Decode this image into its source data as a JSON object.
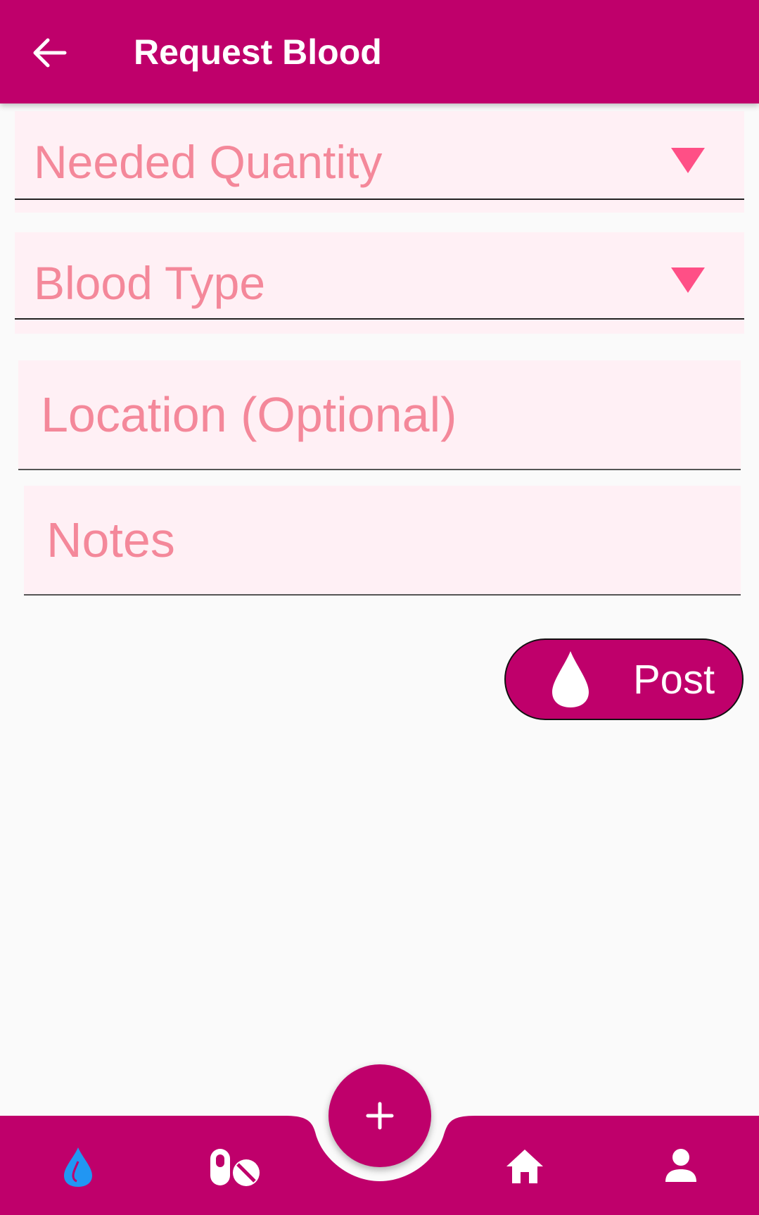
{
  "appbar": {
    "title": "Request Blood"
  },
  "form": {
    "quantity": {
      "label": "Needed Quantity"
    },
    "blood_type": {
      "label": "Blood Type"
    },
    "location": {
      "placeholder": "Location (Optional)",
      "value": ""
    },
    "notes": {
      "placeholder": "Notes",
      "value": ""
    }
  },
  "post_button": {
    "label": "Post"
  },
  "bottom_nav": {
    "items": [
      {
        "icon": "blood-drop-icon",
        "active": true
      },
      {
        "icon": "pills-icon",
        "active": false
      },
      {
        "icon": "add-icon",
        "active": false
      },
      {
        "icon": "home-icon",
        "active": false
      },
      {
        "icon": "profile-icon",
        "active": false
      }
    ]
  },
  "colors": {
    "primary": "#bf006b",
    "field_bg": "#fff0f5",
    "label": "#f4889a",
    "arrow": "#ff4f86",
    "active_icon": "#2196f3"
  }
}
